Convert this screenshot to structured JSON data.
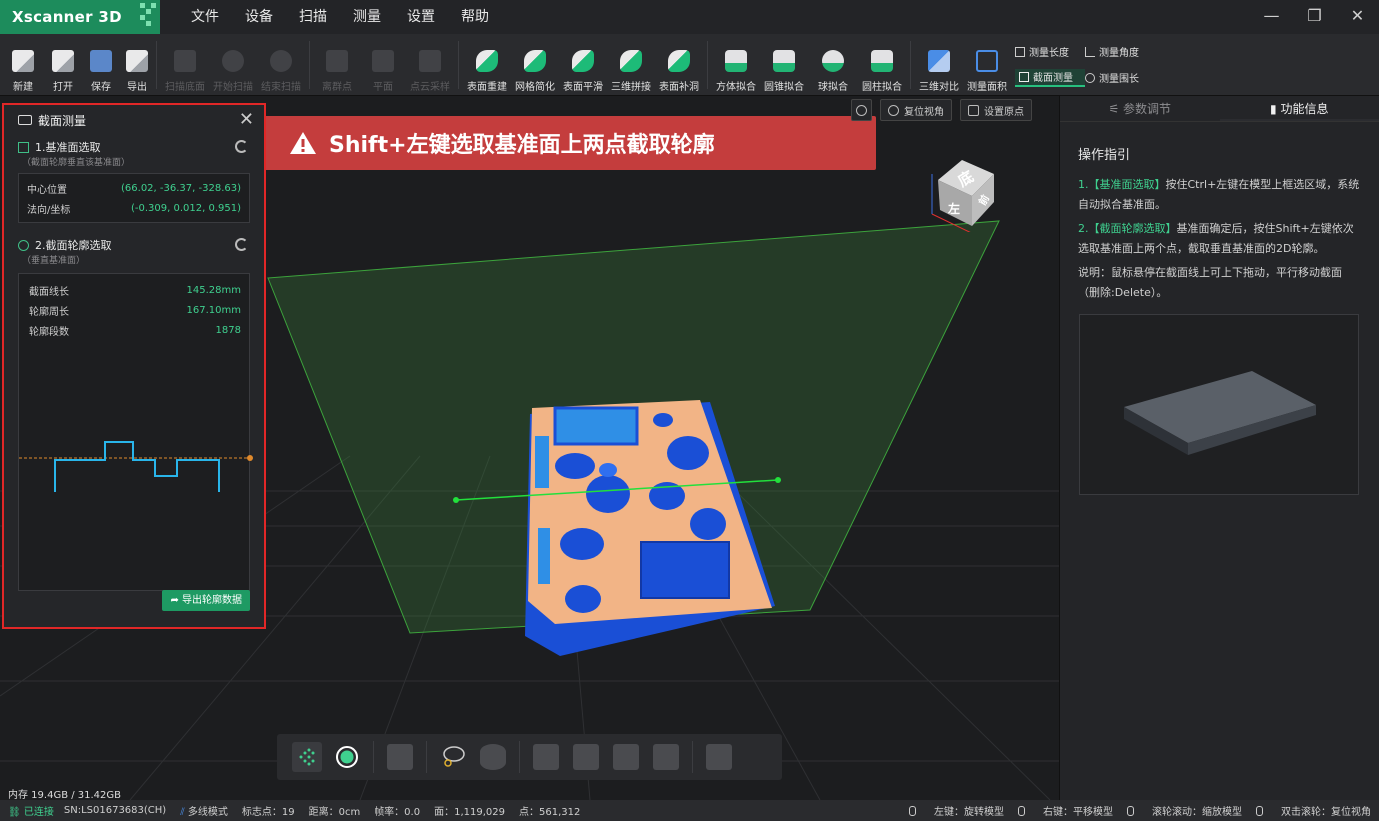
{
  "app": {
    "logo": "Xscanner 3D"
  },
  "menu": [
    "文件",
    "设备",
    "扫描",
    "测量",
    "设置",
    "帮助"
  ],
  "window_buttons": [
    "—",
    "❐",
    "✕"
  ],
  "toolbar": {
    "file_tools": [
      {
        "label": "新建",
        "icon": "new-file-icon"
      },
      {
        "label": "打开",
        "icon": "open-file-icon"
      },
      {
        "label": "保存",
        "icon": "save-icon"
      },
      {
        "label": "导出",
        "icon": "export-icon"
      }
    ],
    "scan_tools": [
      {
        "label": "扫描底面",
        "icon": "scan-base-icon"
      },
      {
        "label": "开始扫描",
        "icon": "play-icon"
      },
      {
        "label": "结束扫描",
        "icon": "stop-icon"
      }
    ],
    "cloud_tools": [
      {
        "label": "离群点",
        "icon": "outlier-icon"
      },
      {
        "label": "平面",
        "icon": "plane-icon"
      },
      {
        "label": "点云采样",
        "icon": "point-sample-icon"
      }
    ],
    "mesh_tools": [
      {
        "label": "表面重建",
        "icon": "surface-rebuild-icon"
      },
      {
        "label": "网格简化",
        "icon": "mesh-simplify-icon"
      },
      {
        "label": "表面平滑",
        "icon": "surface-smooth-icon"
      },
      {
        "label": "三维拼接",
        "icon": "stitch-3d-icon"
      },
      {
        "label": "表面补洞",
        "icon": "fill-hole-icon"
      }
    ],
    "fit_tools": [
      {
        "label": "方体拟合",
        "icon": "box-fit-icon"
      },
      {
        "label": "圆锥拟合",
        "icon": "cone-fit-icon"
      },
      {
        "label": "球拟合",
        "icon": "sphere-fit-icon"
      },
      {
        "label": "圆柱拟合",
        "icon": "cylinder-fit-icon"
      }
    ],
    "measure_tools": [
      {
        "label": "三维对比",
        "icon": "compare-3d-icon"
      },
      {
        "label": "测量面积",
        "icon": "area-icon"
      }
    ],
    "mini_tools": [
      {
        "label": "测量长度",
        "icon": "length-icon"
      },
      {
        "label": "测量角度",
        "icon": "angle-icon"
      },
      {
        "label": "截面测量",
        "icon": "section-icon",
        "active": true
      },
      {
        "label": "测量围长",
        "icon": "girth-icon"
      }
    ]
  },
  "banner": {
    "text": "Shift+左键选取基准面上两点截取轮廓"
  },
  "viewport_buttons": [
    {
      "label": "复位视角",
      "icon": "reset-view-icon"
    },
    {
      "label": "设置原点",
      "icon": "set-origin-icon"
    }
  ],
  "view_cube": {
    "top_face": "底",
    "front_face": "左",
    "side_face": "前"
  },
  "left_panel": {
    "title": "截面测量",
    "section1": {
      "title": "1.基准面选取",
      "subtitle": "（截面轮廓垂直该基准面）",
      "rows": [
        {
          "key": "中心位置",
          "value": "(66.02, -36.37, -328.63)"
        },
        {
          "key": "法向/坐标",
          "value": "(-0.309, 0.012, 0.951)"
        }
      ]
    },
    "section2": {
      "title": "2.截面轮廓选取",
      "subtitle": "（垂直基准面）",
      "rows": [
        {
          "key": "截面线长",
          "value": "145.28mm"
        },
        {
          "key": "轮廓周长",
          "value": "167.10mm"
        },
        {
          "key": "轮廓段数",
          "value": "1878"
        }
      ]
    },
    "export_label": "导出轮廓数据"
  },
  "right_panel": {
    "tabs": [
      "参数调节",
      "功能信息"
    ],
    "active_tab": 1,
    "guide_title": "操作指引",
    "step1_tag": "1.【基准面选取】",
    "step1_text": "按住Ctrl+左键在模型上框选区域，系统自动拟合基准面。",
    "step2_tag": "2.【截面轮廓选取】",
    "step2_text": "基准面确定后，按住Shift+左键依次选取基准面上两个点，截取垂直基准面的2D轮廓。",
    "note": "说明：鼠标悬停在截面线上可上下拖动，平行移动截面（删除:Delete）。"
  },
  "bottom_toolbar": [
    {
      "name": "point-cloud-icon"
    },
    {
      "name": "record-icon",
      "active": true
    },
    {
      "name": "cube-view-icon"
    },
    {
      "name": "lasso-icon"
    },
    {
      "name": "database-icon"
    },
    {
      "name": "delete-select-icon"
    },
    {
      "name": "copy-select-icon"
    },
    {
      "name": "confirm-select-icon"
    },
    {
      "name": "clear-select-icon"
    },
    {
      "name": "undo-icon"
    }
  ],
  "memory": "内存 19.4GB / 31.42GB",
  "status": {
    "connection": "已连接",
    "sn": "SN:LS01673683(CH)",
    "mode": "多线模式",
    "markers": "标志点：19",
    "distance": "距离：0cm",
    "framerate": "帧率：0.0",
    "faces": "面：1,119,029",
    "points": "点：561,312",
    "left_key": "左键：旋转模型",
    "right_key": "右键：平移模型",
    "wheel": "滚轮滚动：缩放模型",
    "double_click": "双击滚轮：复位视角"
  },
  "colors": {
    "accent": "#1e9a63",
    "banner": "#c43d3d",
    "profile": "#29b5ea",
    "model_orange": "#f2b486",
    "model_blue": "#1a4fd6"
  }
}
